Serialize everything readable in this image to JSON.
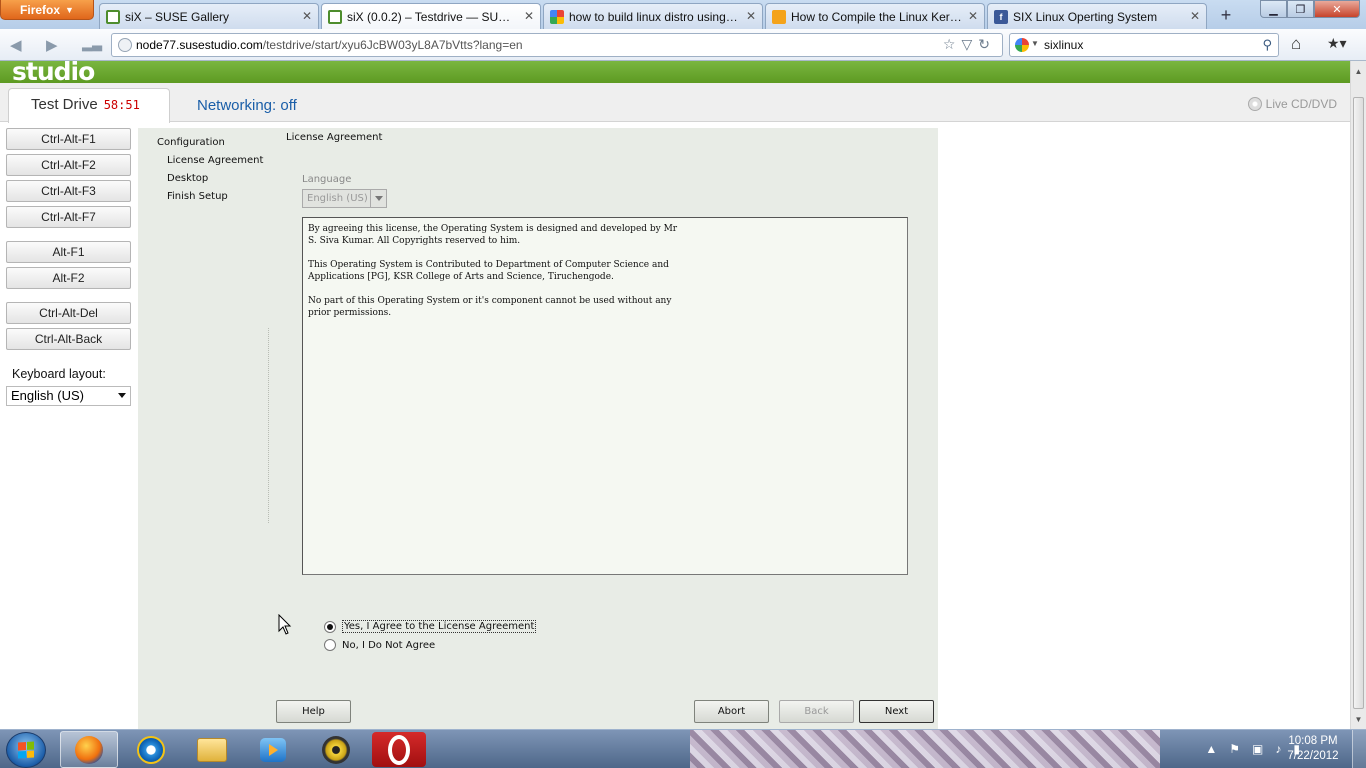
{
  "browser": {
    "menu_label": "Firefox",
    "tabs": [
      {
        "title": "siX – SUSE Gallery",
        "favicon": "suse-icon"
      },
      {
        "title": "siX (0.0.2) – Testdrive — SUSE St...",
        "favicon": "suse-icon"
      },
      {
        "title": "how to build linux distro using li...",
        "favicon": "google-icon"
      },
      {
        "title": "How to Compile the Linux Kern...",
        "favicon": "blogger-icon"
      },
      {
        "title": "SIX Linux Operting System",
        "favicon": "facebook-icon"
      }
    ],
    "url_host": "node77.susestudio.com",
    "url_path": "/testdrive/start/xyu6JcBW03yL8A7bVtts?lang=en",
    "search_value": "sixlinux"
  },
  "studio": {
    "logo": "studio",
    "testdrive_label": "Test Drive",
    "timer": "58:51",
    "networking": "Networking: off",
    "live_cd": "Live CD/DVD",
    "key_buttons": {
      "ctrl_alt_f1": "Ctrl-Alt-F1",
      "ctrl_alt_f2": "Ctrl-Alt-F2",
      "ctrl_alt_f3": "Ctrl-Alt-F3",
      "ctrl_alt_f7": "Ctrl-Alt-F7",
      "alt_f1": "Alt-F1",
      "alt_f2": "Alt-F2",
      "ctrl_alt_del": "Ctrl-Alt-Del",
      "ctrl_alt_back": "Ctrl-Alt-Back"
    },
    "keyboard_label": "Keyboard layout:",
    "keyboard_value": "English (US)"
  },
  "installer": {
    "steps": {
      "configuration": "Configuration",
      "license": "License Agreement",
      "desktop": "Desktop",
      "finish": "Finish Setup"
    },
    "title": "License Agreement",
    "language_label": "Language",
    "language_value": "English (US)",
    "license_paragraphs": [
      "By agreeing this license, the Operating System is designed and developed by Mr\nS. Siva Kumar. All Copyrights reserved to him.",
      "This Operating System is Contributed to Department of Computer Science and\nApplications [PG], KSR College of Arts and Science, Tiruchengode.",
      "No part of this Operating System or it's component cannot be used without any\nprior permissions."
    ],
    "agree_label": "Yes, I Agree to the License Agreement",
    "disagree_label": "No, I Do Not Agree",
    "help_label": "Help",
    "abort_label": "Abort",
    "back_label": "Back",
    "next_label": "Next"
  },
  "taskbar": {
    "time": "10:08 PM",
    "date": "7/22/2012"
  }
}
